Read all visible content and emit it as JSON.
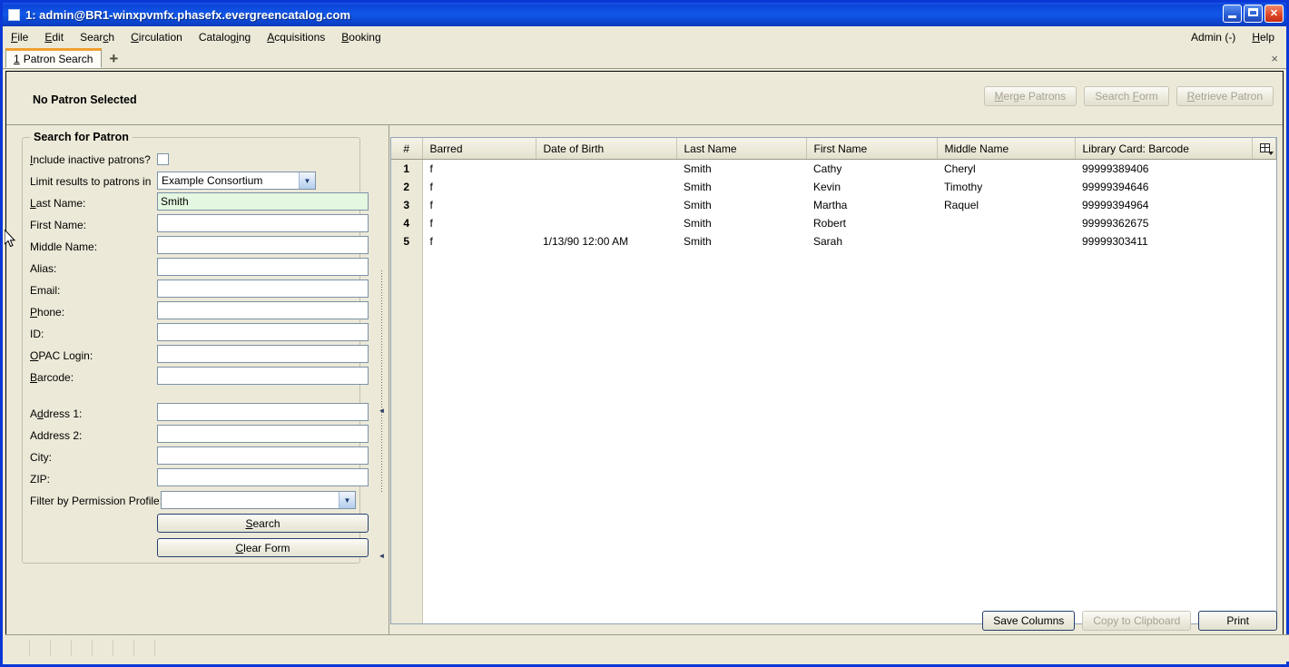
{
  "window": {
    "title": "1: admin@BR1-winxpvmfx.phasefx.evergreencatalog.com",
    "minimize_label": "Minimize",
    "maximize_label": "Maximize",
    "close_label": "Close"
  },
  "menubar": {
    "items": [
      {
        "label": "File",
        "accel_index": 0
      },
      {
        "label": "Edit",
        "accel_index": 0
      },
      {
        "label": "Search",
        "accel_index": 4
      },
      {
        "label": "Circulation",
        "accel_index": 0
      },
      {
        "label": "Cataloging",
        "accel_index": 7
      },
      {
        "label": "Acquisitions",
        "accel_index": 0
      },
      {
        "label": "Booking",
        "accel_index": 0
      }
    ],
    "right_items": [
      {
        "label": "Admin (-)"
      },
      {
        "label": "Help"
      }
    ]
  },
  "tabs": {
    "active": {
      "number": "1",
      "label": "Patron Search"
    },
    "add_label": "+",
    "close_label": "×"
  },
  "patron_bar": {
    "status": "No Patron Selected",
    "buttons": [
      {
        "label": "Merge Patrons",
        "enabled": false
      },
      {
        "label": "Search Form",
        "enabled": false
      },
      {
        "label": "Retrieve Patron",
        "enabled": false
      }
    ]
  },
  "search_form": {
    "legend": "Search for Patron",
    "include_inactive": {
      "label": "Include inactive patrons?",
      "checked": false
    },
    "limit_results": {
      "label": "Limit results to patrons in",
      "value": "Example Consortium"
    },
    "fields": [
      {
        "label": "Last Name:",
        "value": "Smith",
        "placeholder": "",
        "focused": true
      },
      {
        "label": "First Name:",
        "value": "",
        "placeholder": "",
        "focused": false
      },
      {
        "label": "Middle Name:",
        "value": "",
        "placeholder": "",
        "focused": false
      },
      {
        "label": "Alias:",
        "value": "",
        "placeholder": "",
        "focused": false
      },
      {
        "label": "Email:",
        "value": "",
        "placeholder": "",
        "focused": false
      },
      {
        "label": "Phone:",
        "value": "",
        "placeholder": "",
        "focused": false
      },
      {
        "label": "ID:",
        "value": "",
        "placeholder": "",
        "focused": false
      },
      {
        "label": "OPAC Login:",
        "value": "",
        "placeholder": "",
        "focused": false
      },
      {
        "label": "Barcode:",
        "value": "",
        "placeholder": "",
        "focused": false
      }
    ],
    "address_fields": [
      {
        "label": "Address 1:",
        "value": ""
      },
      {
        "label": "Address 2:",
        "value": ""
      },
      {
        "label": "City:",
        "value": ""
      },
      {
        "label": "ZIP:",
        "value": ""
      }
    ],
    "permission_profile": {
      "label": "Filter by Permission Profile:",
      "value": ""
    },
    "search_button": "Search",
    "clear_button": "Clear Form"
  },
  "results": {
    "columns": [
      "#",
      "Barred",
      "Date of Birth",
      "Last Name",
      "First Name",
      "Middle Name",
      "Library Card: Barcode"
    ],
    "column_picker_icon": "column-picker-icon",
    "rows": [
      {
        "num": "1",
        "barred": "f",
        "dob": "",
        "last": "Smith",
        "first": "Cathy",
        "middle": "Cheryl",
        "barcode": "99999389406"
      },
      {
        "num": "2",
        "barred": "f",
        "dob": "",
        "last": "Smith",
        "first": "Kevin",
        "middle": "Timothy",
        "barcode": "99999394646"
      },
      {
        "num": "3",
        "barred": "f",
        "dob": "",
        "last": "Smith",
        "first": "Martha",
        "middle": "Raquel",
        "barcode": "99999394964"
      },
      {
        "num": "4",
        "barred": "f",
        "dob": "",
        "last": "Smith",
        "first": "Robert",
        "middle": "",
        "barcode": "99999362675"
      },
      {
        "num": "5",
        "barred": "f",
        "dob": "1/13/90 12:00 AM",
        "last": "Smith",
        "first": "Sarah",
        "middle": "",
        "barcode": "99999303411"
      }
    ],
    "buttons": [
      {
        "label": "Save Columns",
        "enabled": true
      },
      {
        "label": "Copy to Clipboard",
        "enabled": false
      },
      {
        "label": "Print",
        "enabled": true
      }
    ]
  },
  "colors": {
    "titlebar_blue": "#0a44d8",
    "window_border": "#0a38d6",
    "chrome_beige": "#ece9d8",
    "focus_field_green": "#e4f7e0",
    "active_tab_accent": "#f0a030"
  }
}
